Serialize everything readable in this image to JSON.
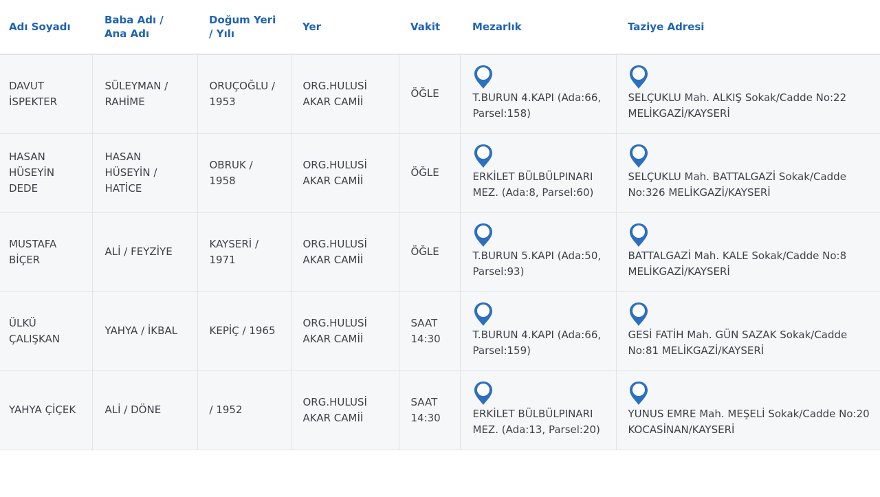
{
  "table": {
    "headers": [
      "Adı Soyadı",
      "Baba Adı / Ana Adı",
      "Doğum Yeri / Yılı",
      "Yer",
      "Vakit",
      "Mezarlık",
      "Taziye Adresi"
    ],
    "rows": [
      {
        "name": "DAVUT İSPEKTER",
        "parents": "SÜLEYMAN / RAHİME",
        "birth": "ORUÇOĞLU / 1953",
        "place": "ORG.HULUSİ AKAR CAMİİ",
        "time": "ÖĞLE",
        "cemetery": "T.BURUN 4.KAPI (Ada:66, Parsel:158)",
        "address": "SELÇUKLU Mah. ALKIŞ Sokak/Cadde No:22 MELİKGAZİ/KAYSERİ"
      },
      {
        "name": "HASAN HÜSEYİN DEDE",
        "parents": "HASAN HÜSEYİN / HATİCE",
        "birth": "OBRUK / 1958",
        "place": "ORG.HULUSİ AKAR CAMİİ",
        "time": "ÖĞLE",
        "cemetery": "ERKİLET BÜLBÜLPINARI MEZ. (Ada:8, Parsel:60)",
        "address": "SELÇUKLU Mah. BATTALGAZİ Sokak/Cadde No:326 MELİKGAZİ/KAYSERİ"
      },
      {
        "name": "MUSTAFA BİÇER",
        "parents": "ALİ / FEYZİYE",
        "birth": "KAYSERİ / 1971",
        "place": "ORG.HULUSİ AKAR CAMİİ",
        "time": "ÖĞLE",
        "cemetery": "T.BURUN 5.KAPI (Ada:50, Parsel:93)",
        "address": "BATTALGAZİ Mah. KALE Sokak/Cadde No:8 MELİKGAZİ/KAYSERİ"
      },
      {
        "name": "ÜLKÜ ÇALIŞKAN",
        "parents": "YAHYA / İKBAL",
        "birth": "KEPİÇ / 1965",
        "place": "ORG.HULUSİ AKAR CAMİİ",
        "time": "SAAT 14:30",
        "cemetery": "T.BURUN 4.KAPI (Ada:66, Parsel:159)",
        "address": "GESİ FATİH Mah. GÜN SAZAK Sokak/Cadde No:81 MELİKGAZİ/KAYSERİ"
      },
      {
        "name": "YAHYA ÇİÇEK",
        "parents": "ALİ / DÖNE",
        "birth": "/ 1952",
        "place": "ORG.HULUSİ AKAR CAMİİ",
        "time": "SAAT 14:30",
        "cemetery": "ERKİLET BÜLBÜLPINARI MEZ. (Ada:13, Parsel:20)",
        "address": "YUNUS EMRE Mah. MEŞELİ Sokak/Cadde No:20 KOCASİNAN/KAYSERİ"
      }
    ]
  },
  "icons": {
    "cemetery_pin": "map-pin-icon",
    "address_pin": "map-pin-icon"
  },
  "colors": {
    "header_text": "#1f63b5",
    "pin": "#2c6fbf",
    "row_background": "#f6f7f9",
    "body_text": "#3d4148"
  }
}
